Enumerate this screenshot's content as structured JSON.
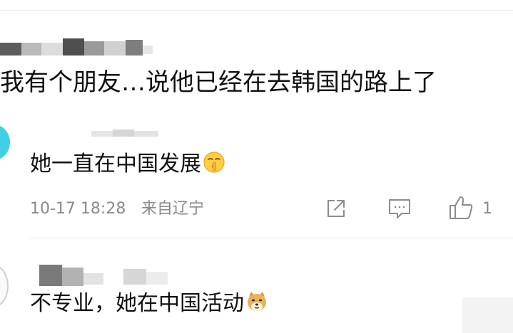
{
  "comments": [
    {
      "text": "我有个朋友…说他已经在去韩国的路上了"
    }
  ],
  "replies": [
    {
      "text": "她一直在中国发展",
      "emoji": "shush-face-emoji",
      "time": "10-17 18:28",
      "location": "来自辽宁",
      "like_count": "1"
    },
    {
      "text": "不专业，她在中国活动",
      "emoji": "doge-emoji"
    }
  ],
  "icons": {
    "share": "share-icon",
    "comment": "comment-icon",
    "like": "thumbs-up-icon"
  },
  "colors": {
    "meta_text": "#8a8a8a",
    "avatar_accent": "#3fd0e3",
    "divider": "#ececec"
  }
}
